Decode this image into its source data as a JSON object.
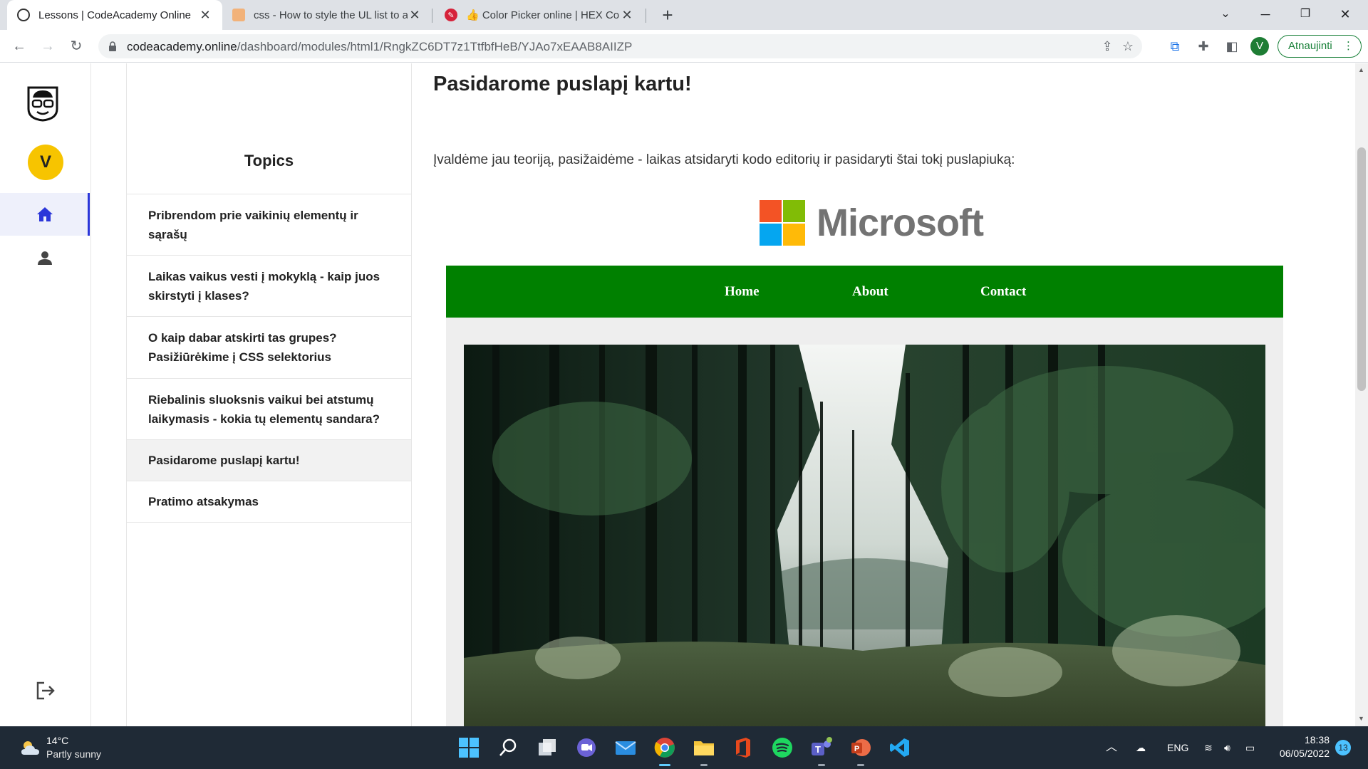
{
  "browser": {
    "tabs": [
      {
        "title": "Lessons | CodeAcademy Online",
        "active": true
      },
      {
        "title": "css - How to style the UL list to a",
        "active": false
      },
      {
        "title": "👍 Color Picker online | HEX Colo",
        "active": false
      }
    ],
    "url_host": "codeacademy.online",
    "url_path": "/dashboard/modules/html1/RngkZC6DT7z1TtfbfHeB/YJAo7xEAAB8AIIZP",
    "profile_initial": "V",
    "update_label": "Atnaujinti"
  },
  "rail": {
    "user_initial": "V"
  },
  "topics": {
    "heading": "Topics",
    "items": [
      {
        "label": "Pribrendom prie vaikinių elementų ir sąrašų",
        "active": false
      },
      {
        "label": "Laikas vaikus vesti į mokyklą - kaip juos skirstyti į klases?",
        "active": false
      },
      {
        "label": "O kaip dabar atskirti tas grupes? Pasižiūrėkime į CSS selektorius",
        "active": false
      },
      {
        "label": "Riebalinis sluoksnis vaikui bei atstumų laikymasis - kokia tų elementų sandara?",
        "active": false
      },
      {
        "label": "Pasidarome puslapį kartu!",
        "active": true
      },
      {
        "label": "Pratimo atsakymas",
        "active": false
      }
    ]
  },
  "lesson": {
    "title": "Pasidarome puslapį kartu!",
    "intro": "Įvaldėme jau teoriją, pasižaidėme - laikas atsidaryti kodo editorių ir pasidaryti štai tokį puslapiuką:",
    "demo": {
      "brand": "Microsoft",
      "nav": [
        "Home",
        "About",
        "Contact"
      ],
      "colors": {
        "nav_bg": "#008000",
        "body_bg": "#eeeeee"
      }
    }
  },
  "taskbar": {
    "weather_temp": "14°C",
    "weather_desc": "Partly sunny",
    "lang": "ENG",
    "time": "18:38",
    "date": "06/05/2022",
    "notifications": "13"
  },
  "colors": {
    "accent": "#2b36d9",
    "avatar": "#f7c400",
    "update_green": "#188038"
  }
}
